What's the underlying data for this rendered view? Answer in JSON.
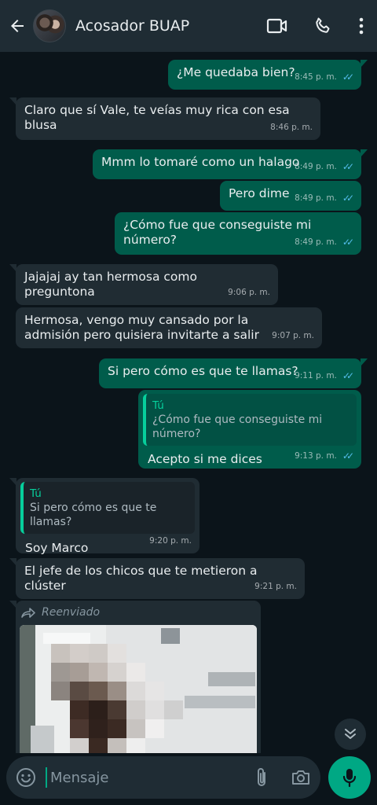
{
  "header": {
    "title": "Acosador BUAP",
    "back_icon": "arrow-left-icon",
    "video_icon": "video-call-icon",
    "call_icon": "phone-icon",
    "menu_icon": "more-vertical-icon"
  },
  "messages": [
    {
      "dir": "out",
      "text": "¿Me quedaba bien?",
      "time": "8:45 p. m.",
      "read": true
    },
    {
      "dir": "in",
      "text": "Claro que sí Vale, te veías muy rica con esa blusa",
      "time": "8:46 p. m."
    },
    {
      "dir": "out",
      "text": "Mmm lo tomaré como un halago",
      "time": "8:49 p. m.",
      "read": true
    },
    {
      "dir": "out",
      "text": "Pero dime",
      "time": "8:49 p. m.",
      "read": true
    },
    {
      "dir": "out",
      "text": "¿Cómo fue que conseguiste mi número?",
      "time": "8:49 p. m.",
      "read": true
    },
    {
      "dir": "in",
      "text": "Jajajaj ay tan hermosa como preguntona",
      "time": "9:06 p. m."
    },
    {
      "dir": "in",
      "text": "Hermosa, vengo muy cansado por la admisión pero quisiera invitarte a salir",
      "time": "9:07 p. m."
    },
    {
      "dir": "out",
      "text": "Si pero cómo es que te llamas?",
      "time": "9:11 p. m.",
      "read": true
    },
    {
      "dir": "out",
      "quote_author": "Tú",
      "quote_text": "¿Cómo fue que conseguiste mi número?",
      "text": "Acepto si me dices",
      "time": "9:13 p. m.",
      "read": true
    },
    {
      "dir": "in",
      "quote_author": "Tú",
      "quote_text": "Si pero cómo es que te llamas?",
      "text": "Soy Marco",
      "time": "9:20 p. m."
    },
    {
      "dir": "in",
      "text": "El  jefe de los chicos que te metieron a clúster",
      "time": "9:21 p. m."
    },
    {
      "dir": "in",
      "forwarded_label": "Reenviado",
      "media": "photo"
    }
  ],
  "input": {
    "placeholder": "Mensaje",
    "emoji_icon": "emoji-icon",
    "attach_icon": "paperclip-icon",
    "camera_icon": "camera-icon",
    "mic_icon": "microphone-icon"
  },
  "colors": {
    "background": "#0b141a",
    "header": "#1f2c34",
    "outgoing_bubble": "#005c4b",
    "incoming_bubble": "#202c33",
    "read_ticks": "#53bdeb",
    "accent": "#00a884"
  }
}
